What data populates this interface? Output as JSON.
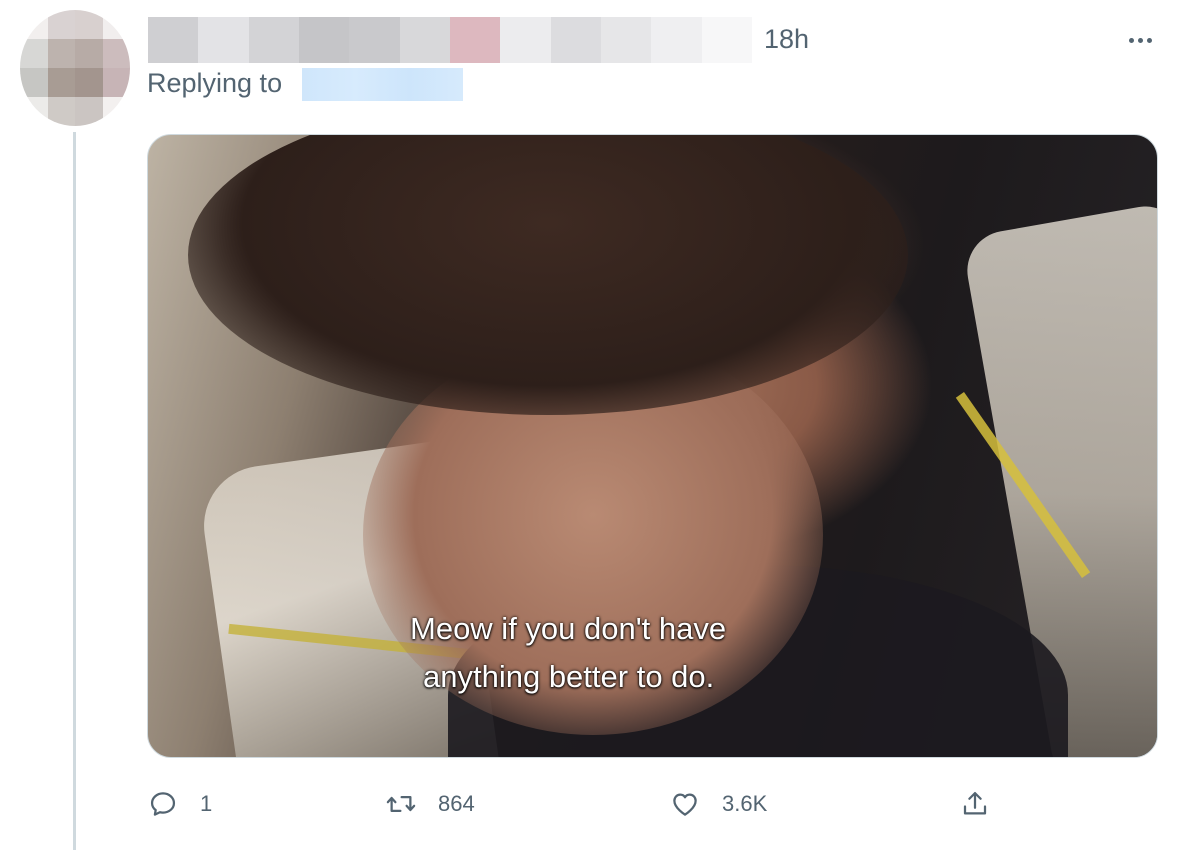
{
  "tweet": {
    "time": "18h",
    "replying_to_label": "Replying to",
    "media": {
      "subtitle_lines": [
        "Meow if you don't have",
        "anything better to do."
      ]
    },
    "actions": {
      "reply": {
        "icon": "comment-icon",
        "count": "1"
      },
      "retweet": {
        "icon": "retweet-icon",
        "count": "864"
      },
      "like": {
        "icon": "heart-icon",
        "count": "3.6K"
      },
      "share": {
        "icon": "share-icon"
      }
    }
  },
  "colors": {
    "secondary_text": "#536471",
    "thread_line": "#cfd9de",
    "redacted_handle": "#d7ebfd"
  }
}
